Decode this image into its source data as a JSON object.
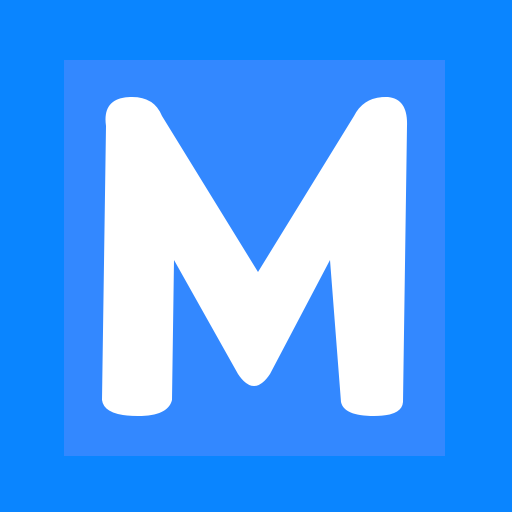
{
  "icon": {
    "name": "m-letter-icon",
    "letter": "M",
    "colors": {
      "background": "#0a85ff",
      "tile": "#3388ff",
      "letter": "#ffffff"
    }
  }
}
